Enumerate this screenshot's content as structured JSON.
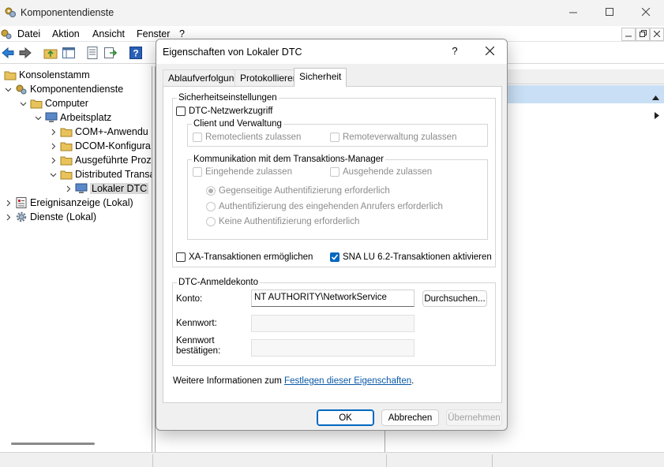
{
  "window": {
    "title": "Komponentendienste",
    "minimize_icon": "minimize-icon",
    "maximize_icon": "maximize-icon",
    "close_icon": "close-icon"
  },
  "menubar": {
    "items": [
      "Datei",
      "Aktion",
      "Ansicht",
      "Fenster",
      "?"
    ]
  },
  "toolbar": {
    "icons": [
      "back-arrow-icon",
      "forward-arrow-icon",
      "folder-up-icon",
      "show-hide-tree-icon",
      "properties-icon",
      "export-list-icon",
      "help-icon"
    ]
  },
  "tree": {
    "items": [
      {
        "label": "Konsolenstamm",
        "icon": "folder-icon",
        "expanded": true
      },
      {
        "label": "Komponentendienste",
        "icon": "component-services-icon",
        "expanded": true
      },
      {
        "label": "Computer",
        "icon": "folder-icon",
        "expanded": true
      },
      {
        "label": "Arbeitsplatz",
        "icon": "computer-icon",
        "expanded": true
      },
      {
        "label": "COM+-Anwendu",
        "icon": "folder-icon",
        "expanded": false
      },
      {
        "label": "DCOM-Konfigura",
        "icon": "folder-icon",
        "expanded": false
      },
      {
        "label": "Ausgeführte Proz",
        "icon": "folder-icon",
        "expanded": false
      },
      {
        "label": "Distributed Transa",
        "icon": "folder-icon",
        "expanded": true
      },
      {
        "label": "Lokaler DTC",
        "icon": "computer-icon",
        "expanded": false,
        "selected": true
      },
      {
        "label": "Ereignisanzeige (Lokal)",
        "icon": "event-viewer-icon",
        "expanded": false
      },
      {
        "label": "Dienste (Lokal)",
        "icon": "services-gear-icon",
        "expanded": false
      }
    ]
  },
  "dialog": {
    "title": "Eigenschaften von Lokaler DTC",
    "help": "?",
    "tabs": [
      {
        "label": "Ablaufverfolgung",
        "active": false
      },
      {
        "label": "Protokollieren",
        "active": false
      },
      {
        "label": "Sicherheit",
        "active": true
      }
    ],
    "security": {
      "group_label": "Sicherheitseinstellungen",
      "network_access": {
        "label": "DTC-Netzwerkzugriff",
        "checked": false
      },
      "client_admin": {
        "group_label": "Client und Verwaltung",
        "remote_clients": {
          "label": "Remoteclients zulassen",
          "checked": false,
          "enabled": false
        },
        "remote_admin": {
          "label": "Remoteverwaltung zulassen",
          "checked": false,
          "enabled": false
        }
      },
      "tm_comm": {
        "group_label": "Kommunikation mit dem Transaktions-Manager",
        "inbound": {
          "label": "Eingehende zulassen",
          "checked": false,
          "enabled": false
        },
        "outbound": {
          "label": "Ausgehende zulassen",
          "checked": false,
          "enabled": false
        },
        "radios": [
          {
            "label": "Gegenseitige Authentifizierung erforderlich",
            "selected": true
          },
          {
            "label": "Authentifizierung des eingehenden Anrufers erforderlich",
            "selected": false
          },
          {
            "label": "Keine Authentifizierung erforderlich",
            "selected": false
          }
        ]
      },
      "xa": {
        "label": "XA-Transaktionen ermöglichen",
        "checked": false
      },
      "sna": {
        "label": "SNA LU 6.2-Transaktionen aktivieren",
        "checked": true
      }
    },
    "account": {
      "group_label": "DTC-Anmeldekonto",
      "account_label": "Konto:",
      "account_value": "NT AUTHORITY\\NetworkService",
      "browse_label": "Durchsuchen...",
      "password_label": "Kennwort:",
      "password_value": "",
      "confirm_label_line1": "Kennwort",
      "confirm_label_line2": "bestätigen:",
      "confirm_value": ""
    },
    "info": {
      "prefix": "Weitere Informationen zum ",
      "link": "Festlegen dieser Eigenschaften",
      "suffix": "."
    },
    "buttons": {
      "ok": "OK",
      "cancel": "Abbrechen",
      "apply": "Übernehmen"
    }
  },
  "colors": {
    "accent": "#0067c0",
    "selection_highlight": "#c9dff5",
    "link": "#0b59a8"
  }
}
